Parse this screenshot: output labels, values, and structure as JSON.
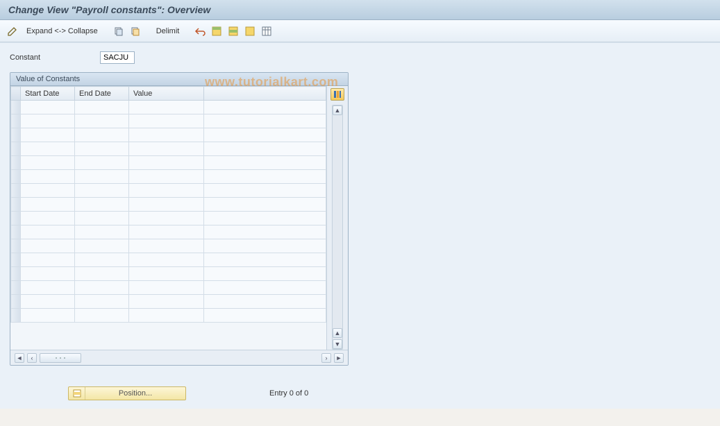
{
  "title": "Change View \"Payroll constants\": Overview",
  "toolbar": {
    "expand_collapse": "Expand <-> Collapse",
    "delimit": "Delimit",
    "icons": {
      "edit": "edit-icon",
      "copy1": "copy-icon",
      "copy2": "copy-new-icon",
      "undo": "undo-icon",
      "select_all": "select-all-icon",
      "select_block": "select-block-icon",
      "deselect_all": "deselect-all-icon",
      "config": "table-settings-icon"
    }
  },
  "fields": {
    "constant_label": "Constant",
    "constant_value": "SACJU"
  },
  "panel": {
    "title": "Value of Constants",
    "columns": {
      "start": "Start Date",
      "end": "End Date",
      "value": "Value"
    },
    "rows_visible": 16
  },
  "footer": {
    "position_label": "Position...",
    "entry_text": "Entry 0 of 0"
  },
  "watermark": "www.tutorialkart.com"
}
